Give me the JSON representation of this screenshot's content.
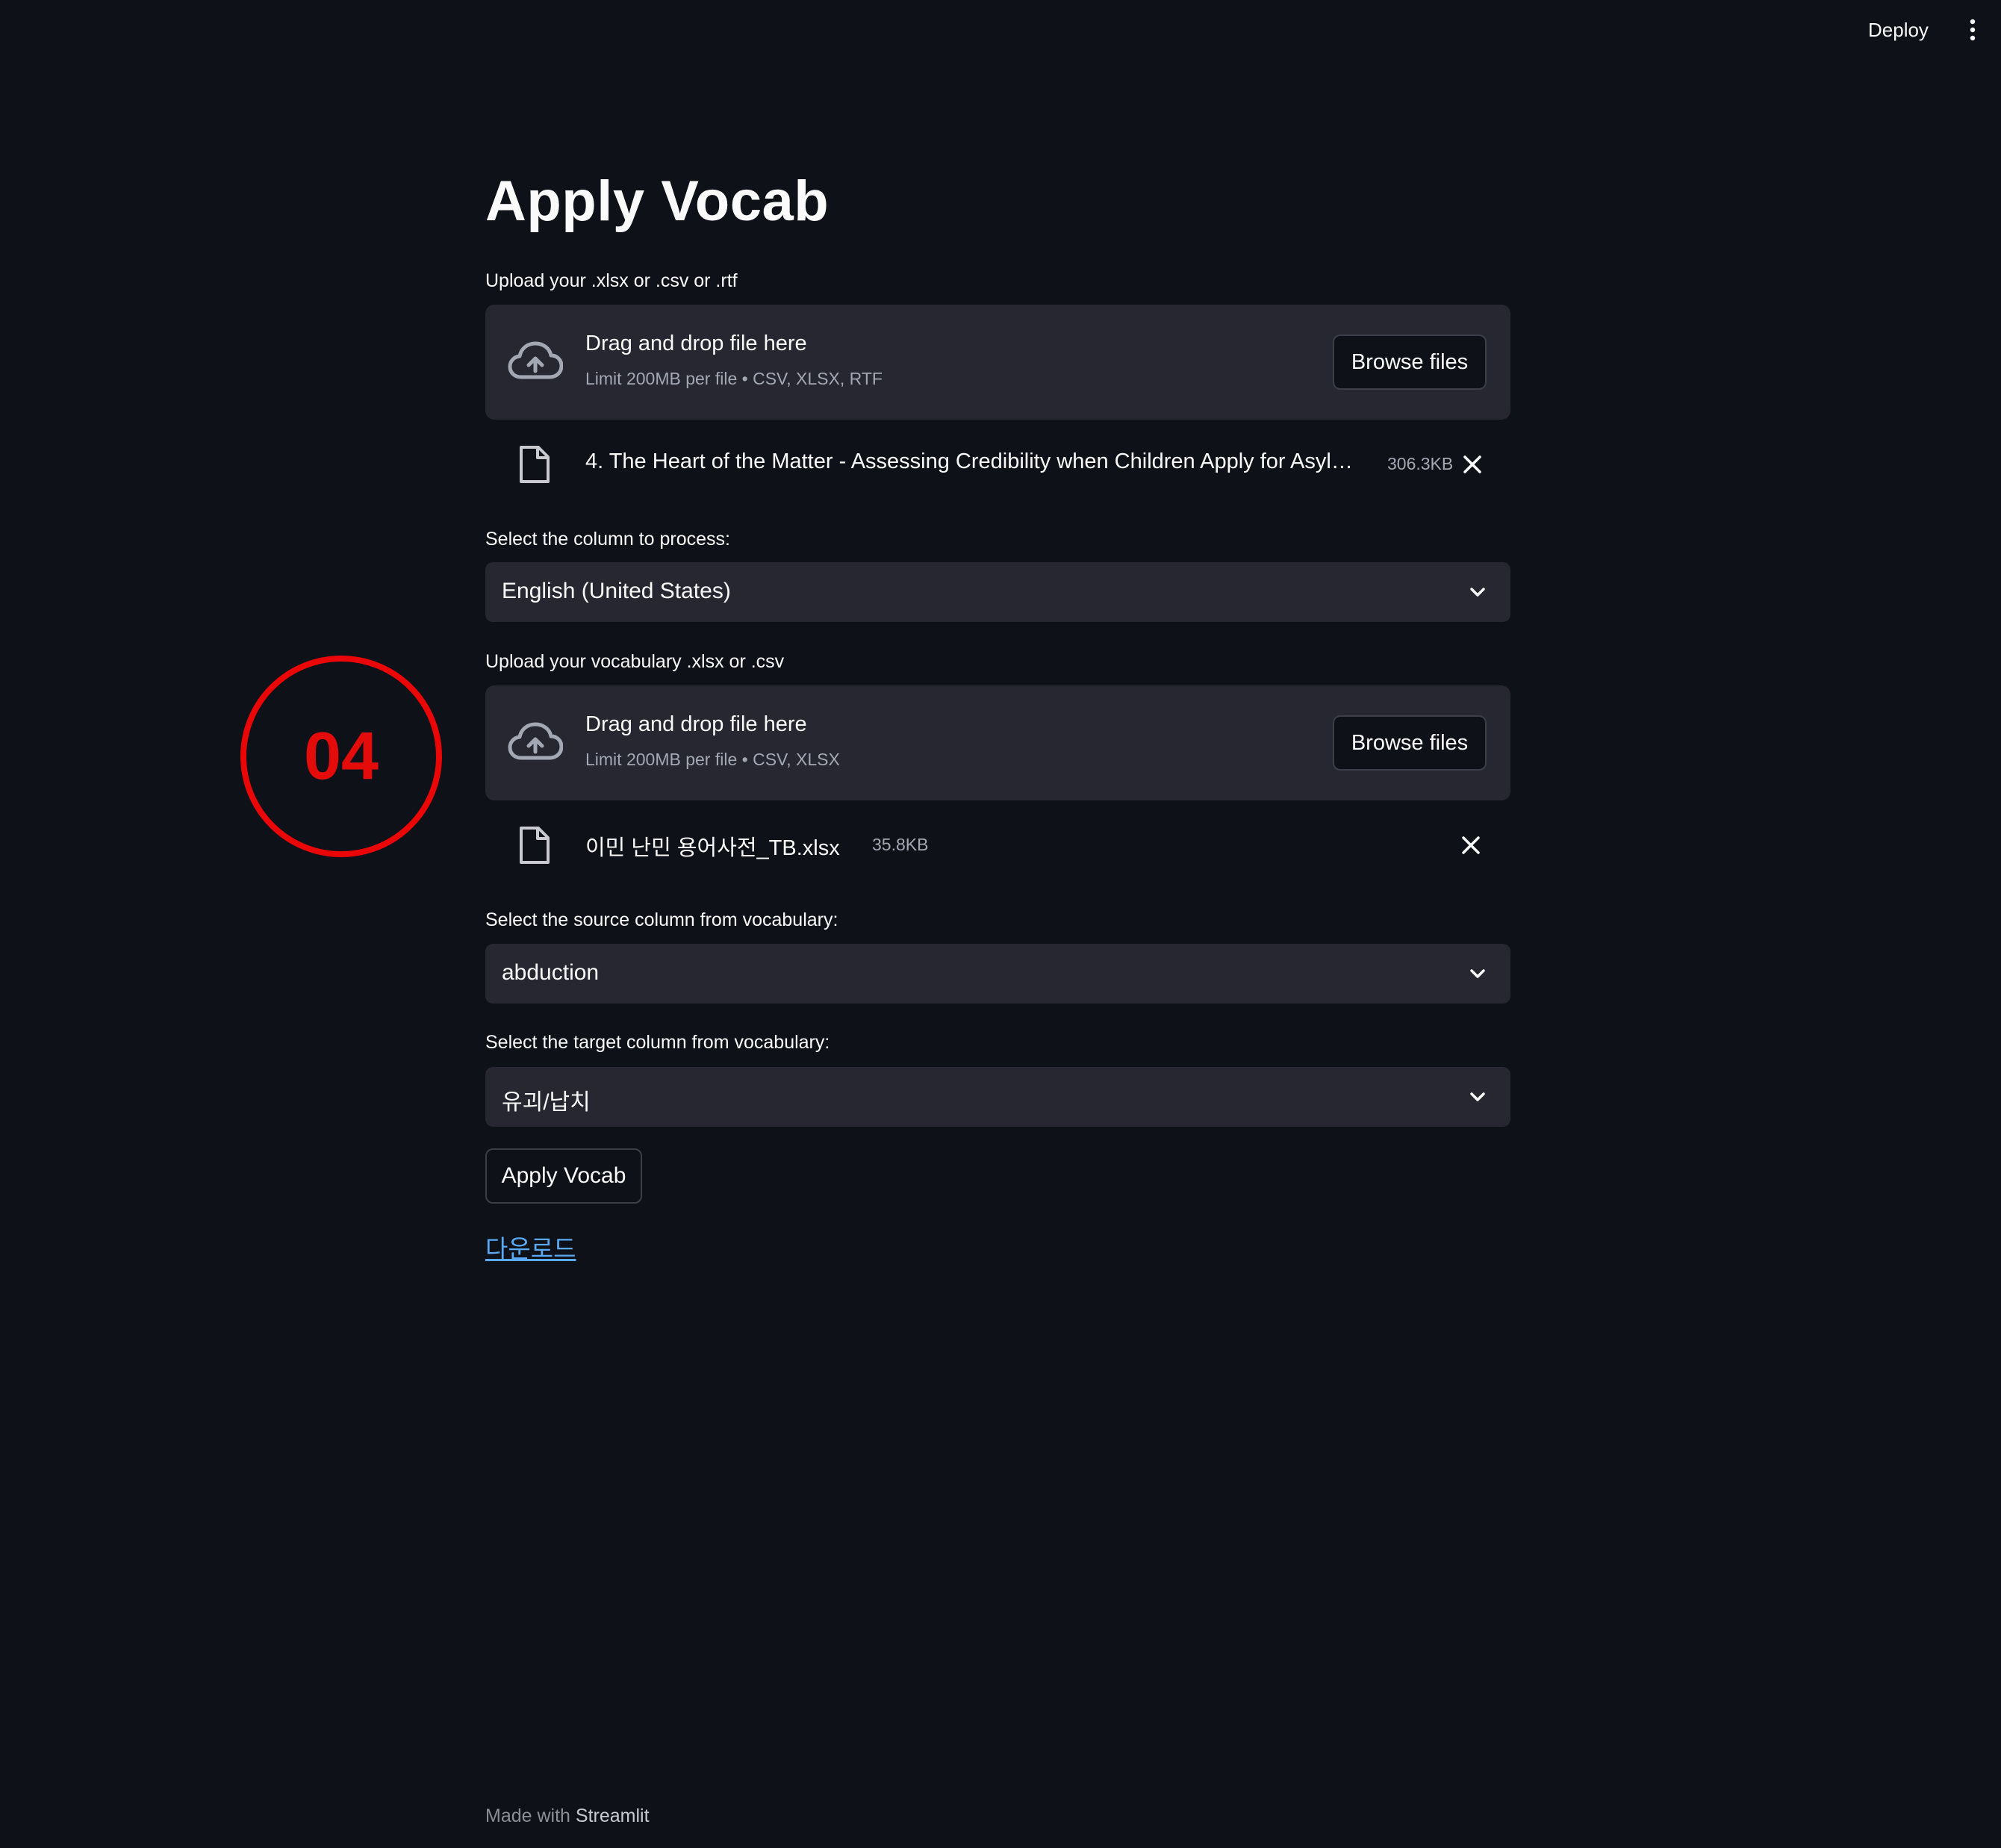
{
  "header": {
    "deploy_label": "Deploy",
    "menu_icon": "vertical-dots-icon"
  },
  "main": {
    "title": "Apply Vocab",
    "upload1": {
      "label": "Upload your .xlsx or .csv or .rtf",
      "drop_text": "Drag and drop file here",
      "limit_text": "Limit 200MB per file • CSV, XLSX, RTF",
      "browse_label": "Browse files",
      "file": {
        "name": "4. The Heart of the Matter - Assessing Credibility when Children Apply for Asylu…",
        "size": "306.3KB"
      }
    },
    "column_select": {
      "label": "Select the column to process:",
      "value": "English (United States)"
    },
    "upload2": {
      "label": "Upload your vocabulary .xlsx or .csv",
      "drop_text": "Drag and drop file here",
      "limit_text": "Limit 200MB per file • CSV, XLSX",
      "browse_label": "Browse files",
      "file": {
        "name": "이민 난민 용어사전_TB.xlsx",
        "size": "35.8KB"
      }
    },
    "source_select": {
      "label": "Select the source column from vocabulary:",
      "value": "abduction"
    },
    "target_select": {
      "label": "Select the target column from vocabulary:",
      "value": "유괴/납치"
    },
    "apply_button": "Apply Vocab",
    "download_link": "다운로드"
  },
  "annotation": {
    "step_number": "04",
    "color": "#e40b0b"
  },
  "footer": {
    "prefix": "Made with",
    "brand": "Streamlit"
  },
  "colors": {
    "background": "#0e1117",
    "panel": "#262730",
    "link": "#5aa9f5"
  }
}
